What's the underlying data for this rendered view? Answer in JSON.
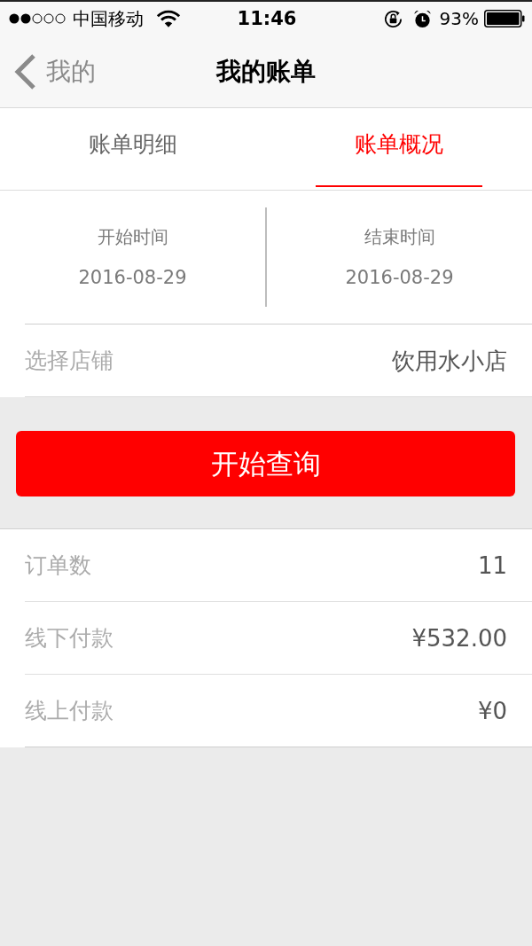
{
  "status_bar": {
    "carrier": "中国移动",
    "time": "11:46",
    "battery": "93%"
  },
  "nav_bar": {
    "back": "我的",
    "title": "我的账单"
  },
  "tabs": [
    {
      "label": "账单明细",
      "selected": false
    },
    {
      "label": "账单概况",
      "selected": true
    }
  ],
  "date_range": [
    {
      "label": "开始时间",
      "value": "2016-08-29"
    },
    {
      "label": "结束时间",
      "value": "2016-08-29"
    }
  ],
  "store": {
    "label": "选择店铺",
    "value": "饮用水小店"
  },
  "query_button": {
    "label": "开始查询"
  },
  "summary": [
    {
      "label": "订单数",
      "value": "11"
    },
    {
      "label": "线下付款",
      "value": "¥532.00"
    },
    {
      "label": "线上付款",
      "value": "¥0"
    }
  ]
}
